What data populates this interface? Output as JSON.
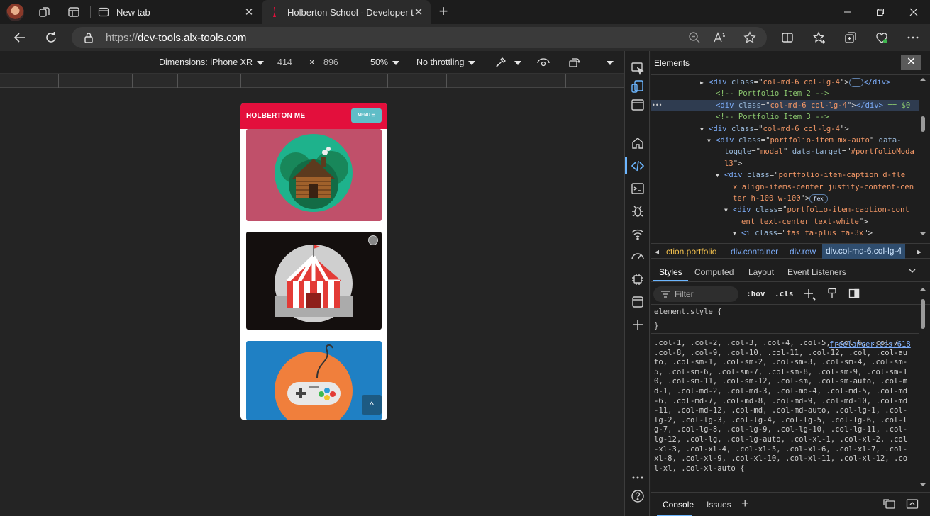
{
  "browser": {
    "tabs": [
      {
        "label": "New tab",
        "close": "✕"
      },
      {
        "label": "Holberton School - Developer to",
        "close": "✕"
      }
    ],
    "new_tab": "+",
    "url_scheme": "https://",
    "url_host": "dev-tools.alx-tools.com"
  },
  "device_toolbar": {
    "dimensions": "Dimensions: iPhone XR",
    "width": "414",
    "times": "×",
    "height": "896",
    "zoom": "50%",
    "throttling": "No throttling"
  },
  "phone": {
    "brand": "HOLBERTON ME",
    "menu": "MENU ☰",
    "scroll_top": "^",
    "colors": {
      "nav": "#e30f3c",
      "card1": "#c0506a",
      "card2": "#140f0e",
      "card3": "#1f80c4",
      "menu": "#5fbdc7"
    }
  },
  "devtools": {
    "panel_title": "Elements",
    "close": "✕",
    "dom": [
      {
        "indent": 70,
        "tri": "▶",
        "parts": [
          [
            "tg",
            "<div "
          ],
          [
            "at",
            "class"
          ],
          [
            "pl",
            "=\""
          ],
          [
            "av",
            "col-md-6 col-lg-4"
          ],
          [
            "pl",
            "\">"
          ],
          [
            "pill",
            "…"
          ],
          [
            "tg",
            "</div>"
          ]
        ]
      },
      {
        "indent": 80,
        "tri": "",
        "parts": [
          [
            "cm",
            "<!-- Portfolio Item 2 -->"
          ]
        ]
      },
      {
        "indent": 80,
        "tri": "",
        "sel": true,
        "parts": [
          [
            "tg",
            "<div "
          ],
          [
            "at",
            "class"
          ],
          [
            "pl",
            "=\""
          ],
          [
            "av",
            "col-md-6 col-lg-4"
          ],
          [
            "pl",
            "\">"
          ],
          [
            "tg",
            "</div>"
          ],
          [
            "cm",
            " == $0"
          ]
        ]
      },
      {
        "indent": 80,
        "tri": "",
        "parts": [
          [
            "cm",
            "<!-- Portfolio Item 3 -->"
          ]
        ]
      },
      {
        "indent": 70,
        "tri": "▼",
        "parts": [
          [
            "tg",
            "<div "
          ],
          [
            "at",
            "class"
          ],
          [
            "pl",
            "=\""
          ],
          [
            "av",
            "col-md-6 col-lg-4"
          ],
          [
            "pl",
            "\">"
          ]
        ]
      },
      {
        "indent": 80,
        "tri": "▼",
        "parts": [
          [
            "tg",
            "<div "
          ],
          [
            "at",
            "class"
          ],
          [
            "pl",
            "=\""
          ],
          [
            "av",
            "portfolio-item mx-auto"
          ],
          [
            "pl",
            "\" "
          ],
          [
            "at",
            "data-"
          ]
        ]
      },
      {
        "indent": 92,
        "tri": "",
        "parts": [
          [
            "at",
            "toggle"
          ],
          [
            "pl",
            "=\""
          ],
          [
            "av",
            "modal"
          ],
          [
            "pl",
            "\" "
          ],
          [
            "at",
            "data-target"
          ],
          [
            "pl",
            "=\""
          ],
          [
            "av",
            "#portfolioModa"
          ]
        ]
      },
      {
        "indent": 92,
        "tri": "",
        "parts": [
          [
            "av",
            "l3"
          ],
          [
            "pl",
            "\">"
          ]
        ]
      },
      {
        "indent": 92,
        "tri": "▼",
        "parts": [
          [
            "tg",
            "<div "
          ],
          [
            "at",
            "class"
          ],
          [
            "pl",
            "=\""
          ],
          [
            "av",
            "portfolio-item-caption d-fle"
          ]
        ]
      },
      {
        "indent": 104,
        "tri": "",
        "parts": [
          [
            "av",
            "x align-items-center justify-content-cen"
          ]
        ]
      },
      {
        "indent": 104,
        "tri": "",
        "parts": [
          [
            "av",
            "ter h-100 w-100"
          ],
          [
            "pl",
            "\">"
          ],
          [
            "pill",
            "flex"
          ]
        ]
      },
      {
        "indent": 104,
        "tri": "▼",
        "parts": [
          [
            "tg",
            "<div "
          ],
          [
            "at",
            "class"
          ],
          [
            "pl",
            "=\""
          ],
          [
            "av",
            "portfolio-item-caption-cont"
          ]
        ]
      },
      {
        "indent": 116,
        "tri": "",
        "parts": [
          [
            "av",
            "ent text-center text-white"
          ],
          [
            "pl",
            "\">"
          ]
        ]
      },
      {
        "indent": 116,
        "tri": "▼",
        "parts": [
          [
            "tg",
            "<i "
          ],
          [
            "at",
            "class"
          ],
          [
            "pl",
            "=\""
          ],
          [
            "av",
            "fas fa-plus fa-3x"
          ],
          [
            "pl",
            "\">"
          ]
        ]
      }
    ],
    "crumbs": [
      "ction.portfolio",
      "div.container",
      "div.row",
      "div.col-md-6.col-lg-4"
    ],
    "style_tabs": [
      "Styles",
      "Computed",
      "Layout",
      "Event Listeners"
    ],
    "filter": "Filter",
    "hov": ":hov",
    "cls": ".cls",
    "element_style_open": "element.style {",
    "element_style_close": "}",
    "rule_source": "freelancer.css:618",
    "rule_selectors": ".col-1, .col-2, .col-3, .col-4, .col-5, .col-6, .col-7, .col-8, .col-9, .col-10, .col-11, .col-12, .col, .col-auto, .col-sm-1, .col-sm-2, .col-sm-3, .col-sm-4, .col-sm-5, .col-sm-6, .col-sm-7, .col-sm-8, .col-sm-9, .col-sm-10, .col-sm-11, .col-sm-12, .col-sm, .col-sm-auto, .col-md-1, .col-md-2, .col-md-3, .col-md-4, .col-md-5, .col-md-6, .col-md-7, .col-md-8, .col-md-9, .col-md-10, .col-md-11, .col-md-12, .col-md, .col-md-auto, .col-lg-1, .col-lg-2, .col-lg-3, .col-lg-4, .col-lg-5, .col-lg-6, .col-lg-7, .col-lg-8, .col-lg-9, .col-lg-10, .col-lg-11, .col-lg-12, .col-lg, .col-lg-auto, .col-xl-1, .col-xl-2, .col-xl-3, .col-xl-4, .col-xl-5, .col-xl-6, .col-xl-7, .col-xl-8, .col-xl-9, .col-xl-10, .col-xl-11, .col-xl-12, .col-xl, .col-xl-auto {",
    "drawer_tabs": [
      "Console",
      "Issues"
    ],
    "drawer_add": "+"
  }
}
